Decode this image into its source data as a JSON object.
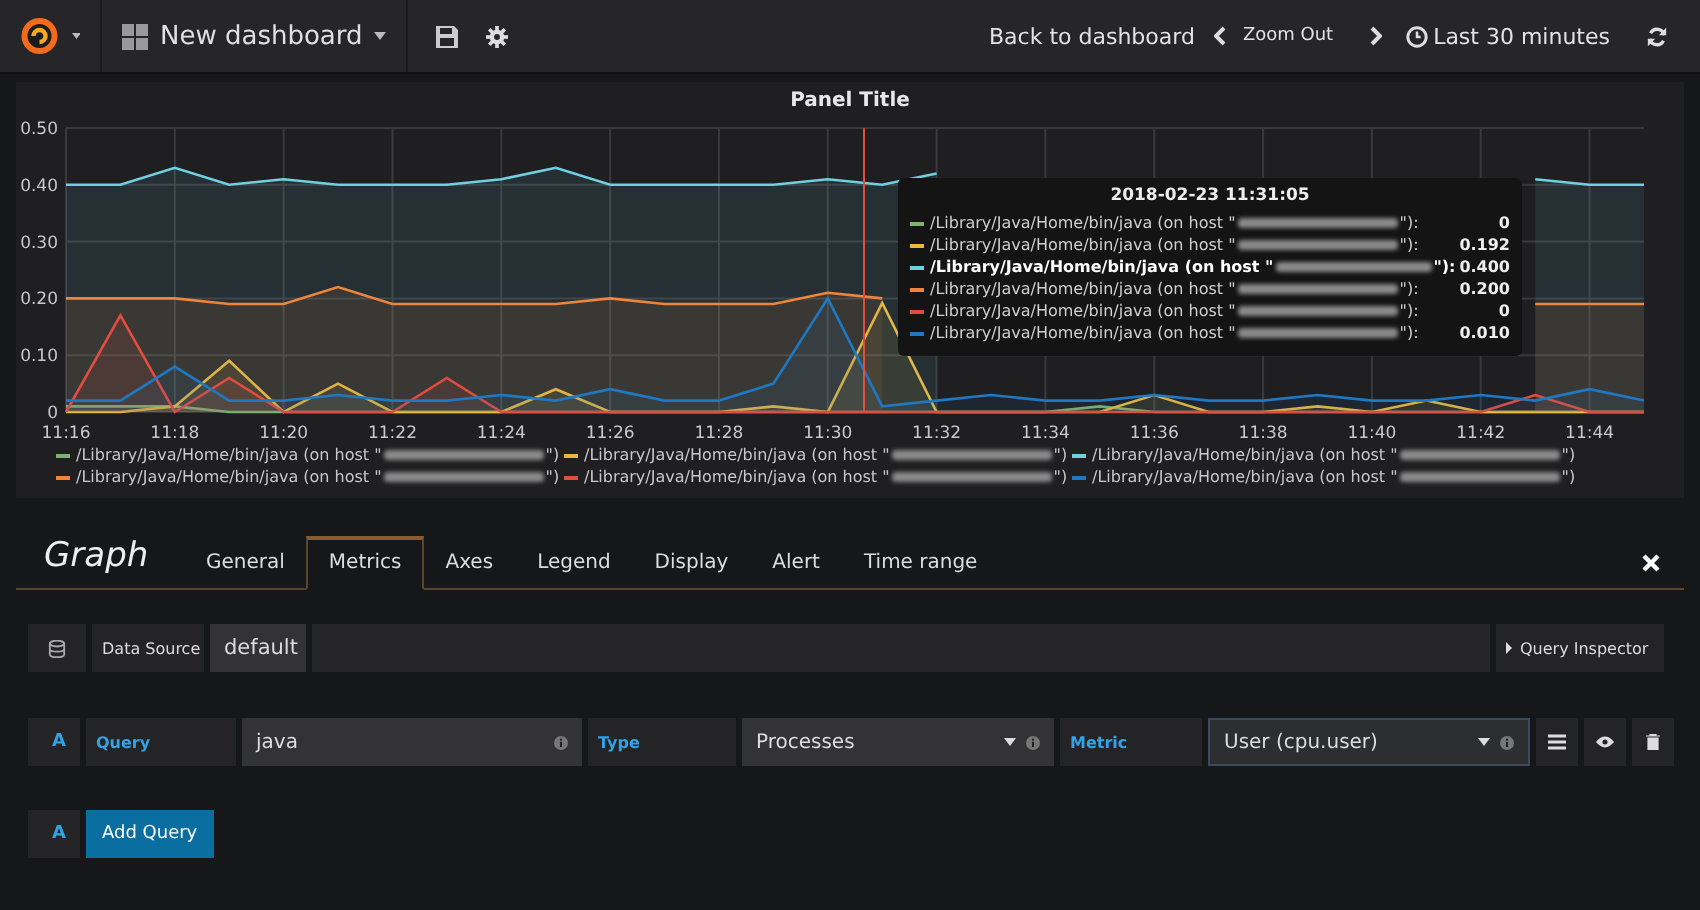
{
  "topbar": {
    "dashboard_title": "New dashboard",
    "back": "Back to dashboard",
    "zoom_out": "Zoom Out",
    "time_range": "Last 30 minutes"
  },
  "panel": {
    "title": "Panel Title",
    "chart_data": {
      "type": "area",
      "stacked": false,
      "grid": true,
      "categories": [
        "11:16",
        null,
        "11:18",
        null,
        "11:20",
        null,
        "11:22",
        null,
        "11:24",
        null,
        "11:26",
        null,
        "11:28",
        null,
        "11:30",
        null,
        "11:32",
        null,
        "11:34",
        null,
        "11:36",
        null,
        "11:38",
        null,
        "11:40",
        null,
        "11:42",
        null,
        "11:44",
        null
      ],
      "ylim": [
        0,
        0.5
      ],
      "yticks": [
        0,
        {
          "value": 0.1,
          "label": "0.10"
        },
        {
          "value": 0.2,
          "label": "0.20"
        },
        {
          "value": 0.3,
          "label": "0.30"
        },
        {
          "value": 0.4,
          "label": "0.40"
        },
        {
          "value": 0.5,
          "label": "0.50"
        }
      ],
      "series": [
        {
          "color": "#7eb26d",
          "values": [
            0.01,
            0.01,
            0.01,
            0,
            0,
            0,
            0,
            0,
            0,
            0,
            0,
            0,
            0,
            0,
            0,
            0,
            0,
            0,
            0,
            0.01,
            0,
            0,
            0,
            0,
            0,
            0,
            0,
            0,
            0,
            0
          ]
        },
        {
          "color": "#eab839",
          "values": [
            0,
            0,
            0.01,
            0.09,
            0,
            0.05,
            0,
            0,
            0,
            0.04,
            0,
            0,
            0,
            0.01,
            0,
            0.192,
            0,
            0,
            0,
            0,
            0.03,
            0,
            0,
            0.01,
            0,
            0.02,
            0,
            0,
            0,
            0
          ]
        },
        {
          "color": "#6ed0e0",
          "values": [
            0.4,
            0.4,
            0.43,
            0.4,
            0.41,
            0.4,
            0.4,
            0.4,
            0.41,
            0.43,
            0.4,
            0.4,
            0.4,
            0.4,
            0.41,
            0.4,
            0.42,
            null,
            null,
            null,
            null,
            null,
            null,
            null,
            null,
            null,
            null,
            0.41,
            0.4,
            0.4
          ]
        },
        {
          "color": "#ef843c",
          "values": [
            0.2,
            0.2,
            0.2,
            0.19,
            0.19,
            0.22,
            0.19,
            0.19,
            0.19,
            0.19,
            0.2,
            0.19,
            0.19,
            0.19,
            0.21,
            0.2,
            null,
            null,
            null,
            null,
            null,
            null,
            null,
            null,
            null,
            null,
            null,
            0.19,
            0.19,
            0.19
          ]
        },
        {
          "color": "#e24d42",
          "values": [
            0,
            0.17,
            0,
            0.06,
            0,
            0,
            0,
            0.06,
            0,
            0,
            0,
            0,
            0,
            0,
            0,
            0,
            0,
            0,
            0,
            0,
            0,
            0,
            0,
            0,
            0,
            0,
            0,
            0.03,
            0,
            0
          ]
        },
        {
          "color": "#1f78c1",
          "values": [
            0.02,
            0.02,
            0.08,
            0.02,
            0.02,
            0.03,
            0.02,
            0.02,
            0.03,
            0.02,
            0.04,
            0.02,
            0.02,
            0.05,
            0.2,
            0.01,
            0.02,
            0.03,
            0.02,
            0.02,
            0.03,
            0.02,
            0.02,
            0.03,
            0.02,
            0.02,
            0.03,
            0.02,
            0.04,
            0.02
          ]
        }
      ]
    },
    "tooltip": {
      "time": "2018-02-23 11:31:05",
      "rows": [
        {
          "label": "/Library/Java/Home/bin/java (on host \"",
          "suffix": "\"):",
          "value": "0",
          "color": "#7eb26d",
          "highlighted": false
        },
        {
          "label": "/Library/Java/Home/bin/java (on host \"",
          "suffix": "\"):",
          "value": "0.192",
          "color": "#eab839",
          "highlighted": false
        },
        {
          "label": "/Library/Java/Home/bin/java (on host \"",
          "suffix": "\"):",
          "value": "0.400",
          "color": "#6ed0e0",
          "highlighted": true
        },
        {
          "label": "/Library/Java/Home/bin/java (on host \"",
          "suffix": "\"):",
          "value": "0.200",
          "color": "#ef843c",
          "highlighted": false
        },
        {
          "label": "/Library/Java/Home/bin/java (on host \"",
          "suffix": "\"):",
          "value": "0",
          "color": "#e24d42",
          "highlighted": false
        },
        {
          "label": "/Library/Java/Home/bin/java (on host \"",
          "suffix": "\"):",
          "value": "0.010",
          "color": "#1f78c1",
          "highlighted": false
        }
      ]
    },
    "legend": [
      {
        "label": "/Library/Java/Home/bin/java (on host \"",
        "suffix": "\")",
        "color": "#7eb26d"
      },
      {
        "label": "/Library/Java/Home/bin/java (on host \"",
        "suffix": "\")",
        "color": "#eab839"
      },
      {
        "label": "/Library/Java/Home/bin/java (on host \"",
        "suffix": "\")",
        "color": "#6ed0e0"
      },
      {
        "label": "/Library/Java/Home/bin/java (on host \"",
        "suffix": "\")",
        "color": "#ef843c"
      },
      {
        "label": "/Library/Java/Home/bin/java (on host \"",
        "suffix": "\")",
        "color": "#e24d42"
      },
      {
        "label": "/Library/Java/Home/bin/java (on host \"",
        "suffix": "\")",
        "color": "#1f78c1"
      }
    ]
  },
  "editor": {
    "title": "Graph",
    "tabs": [
      {
        "label": "General",
        "selected": false
      },
      {
        "label": "Metrics",
        "selected": true
      },
      {
        "label": "Axes",
        "selected": false
      },
      {
        "label": "Legend",
        "selected": false
      },
      {
        "label": "Display",
        "selected": false
      },
      {
        "label": "Alert",
        "selected": false
      },
      {
        "label": "Time range",
        "selected": false
      }
    ],
    "datasource": {
      "label": "Data Source",
      "value": "default"
    },
    "query_inspector": "Query Inspector",
    "query": {
      "ref": "A",
      "query_label": "Query",
      "query_value": "java",
      "type_label": "Type",
      "type_value": "Processes",
      "metric_label": "Metric",
      "metric_value": "User (cpu.user)"
    },
    "add_query": {
      "ref": "A",
      "label": "Add Query"
    }
  }
}
